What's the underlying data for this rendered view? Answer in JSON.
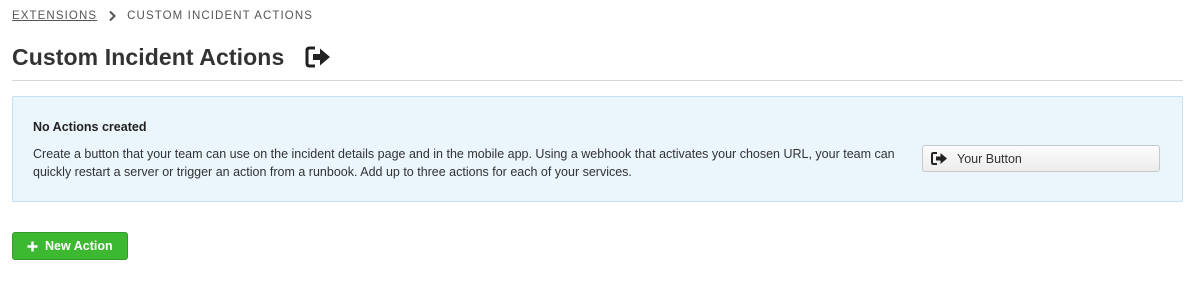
{
  "breadcrumb": {
    "parent_label": "EXTENSIONS",
    "current_label": "CUSTOM INCIDENT ACTIONS"
  },
  "header": {
    "title": "Custom Incident Actions",
    "icon": "sign-out-arrow-icon"
  },
  "empty_state": {
    "title": "No Actions created",
    "description": "Create a button that your team can use on the incident details page and in the mobile app. Using a webhook that activates your chosen URL, your team can quickly restart a server or trigger an action from a runbook. Add up to three actions for each of your services.",
    "sample_button_label": "Your Button",
    "sample_button_icon": "sign-out-arrow-icon"
  },
  "actions": {
    "new_action_label": "New Action",
    "new_action_icon": "plus-icon"
  },
  "colors": {
    "info_background": "#eaf5fc",
    "info_border": "#c4e0f2",
    "primary_green": "#3cb930",
    "text": "#333333"
  }
}
